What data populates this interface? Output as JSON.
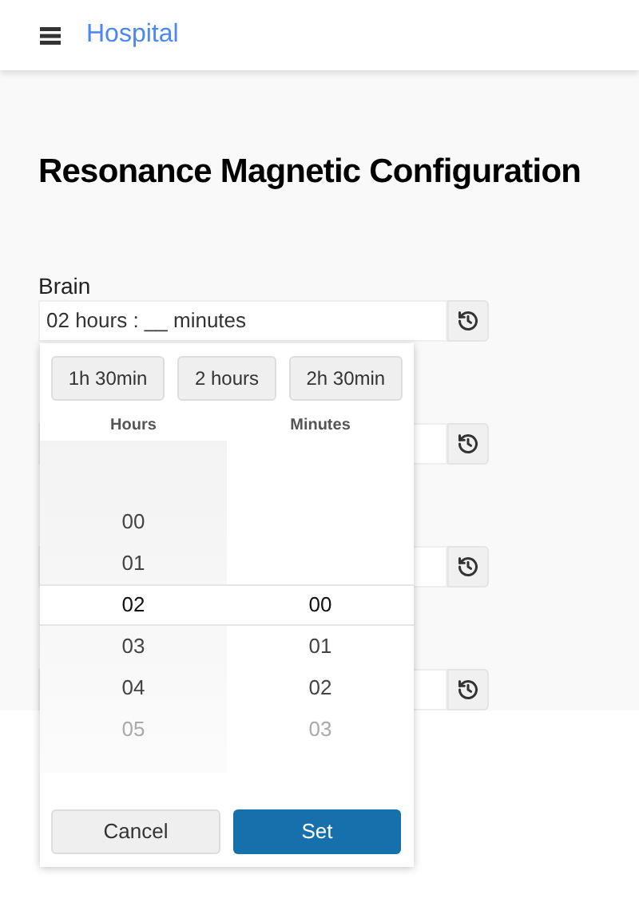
{
  "header": {
    "title": "Hospital"
  },
  "page_title": "Resonance Magnetic Configuration",
  "fields": [
    {
      "kind": "labeled",
      "label": "Brain",
      "value": "02 hours : __ minutes"
    },
    {
      "kind": "covered"
    },
    {
      "kind": "covered"
    },
    {
      "kind": "covered"
    }
  ],
  "picker": {
    "presets": [
      "1h 30min",
      "2 hours",
      "2h 30min"
    ],
    "columns": [
      {
        "title": "Hours",
        "items": [
          {
            "text": "00",
            "selected": false,
            "faded": false
          },
          {
            "text": "01",
            "selected": false,
            "faded": false
          },
          {
            "text": "02",
            "selected": true,
            "faded": false
          },
          {
            "text": "03",
            "selected": false,
            "faded": false
          },
          {
            "text": "04",
            "selected": false,
            "faded": false
          },
          {
            "text": "05",
            "selected": false,
            "faded": true
          }
        ]
      },
      {
        "title": "Minutes",
        "items": [
          {
            "text": "00",
            "selected": true,
            "faded": false
          },
          {
            "text": "01",
            "selected": false,
            "faded": false
          },
          {
            "text": "02",
            "selected": false,
            "faded": false
          },
          {
            "text": "03",
            "selected": false,
            "faded": true
          }
        ]
      }
    ],
    "cancel": "Cancel",
    "set": "Set"
  }
}
